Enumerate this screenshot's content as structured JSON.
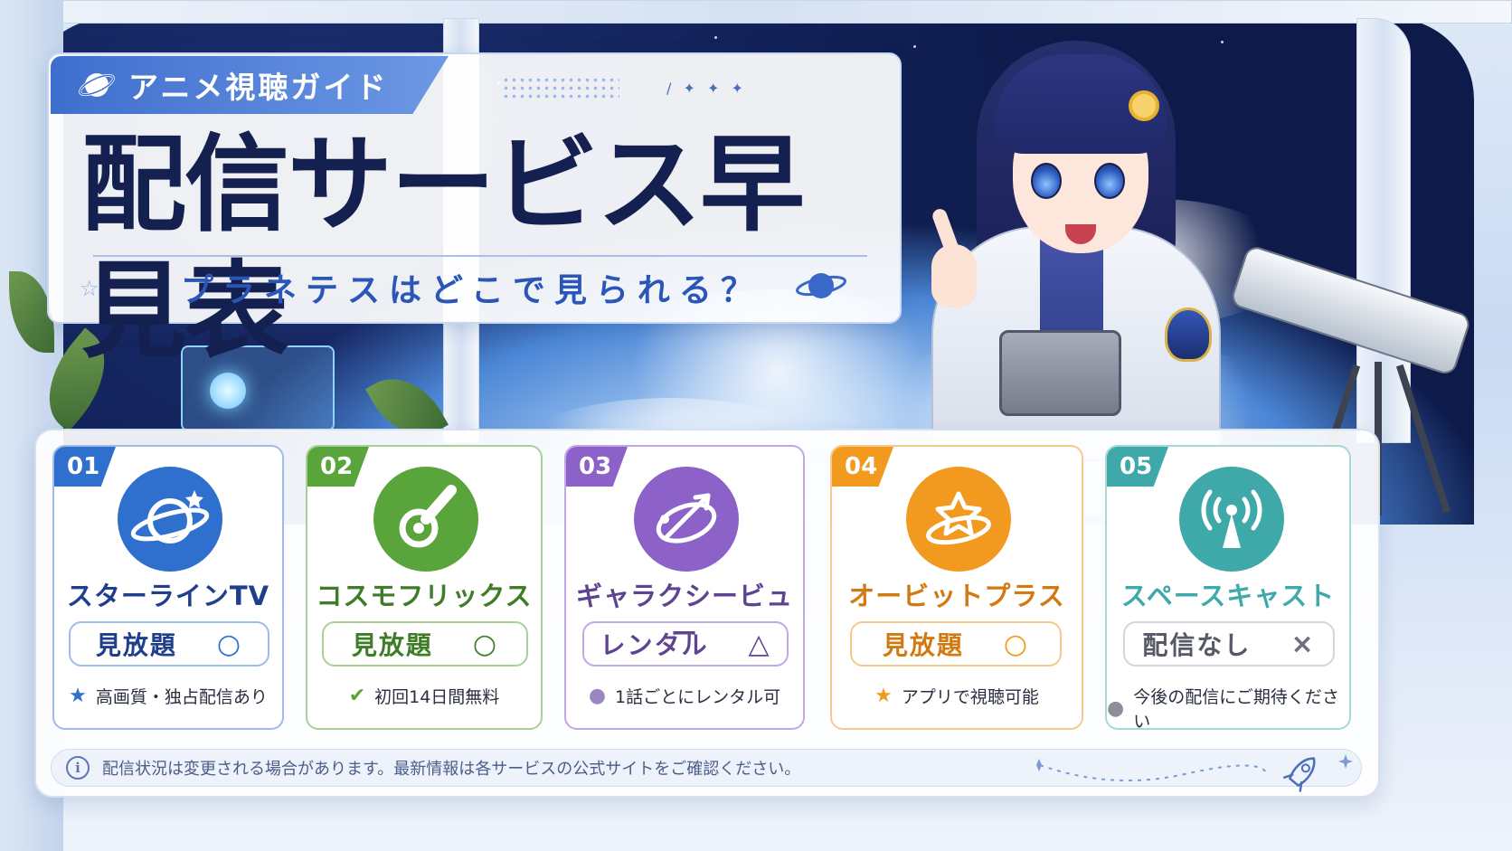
{
  "header": {
    "tag": "アニメ視聴ガイド",
    "title": "配信サービス早見表",
    "subtitle": "プラネテスはどこで見られる？"
  },
  "services": [
    {
      "num": "01",
      "name": "スターラインTV",
      "status": "見放題",
      "mark": "○",
      "note_icon": "star-icon",
      "note_bullet": "★",
      "note": "高画質・独占配信あり",
      "color": "#2f6fcd",
      "pill_text_color": "#1f3f8c"
    },
    {
      "num": "02",
      "name": "コスモフリックス",
      "status": "見放題",
      "mark": "○",
      "note_icon": "check-circle-icon",
      "note_bullet": "✔",
      "note": "初回14日間無料",
      "color": "#5aa43c",
      "pill_text_color": "#3e7d27"
    },
    {
      "num": "03",
      "name": "ギャラクシービュー",
      "status": "レンタル",
      "mark": "△",
      "note_icon": "dot-icon",
      "note_bullet": "●",
      "note": "1話ごとにレンタル可",
      "color": "#8c62c8",
      "pill_text_color": "#5e4490"
    },
    {
      "num": "04",
      "name": "オービットプラス",
      "status": "見放題",
      "mark": "○",
      "note_icon": "star-icon",
      "note_bullet": "★",
      "note": "アプリで視聴可能",
      "color": "#f29a1f",
      "pill_text_color": "#d17a12"
    },
    {
      "num": "05",
      "name": "スペースキャスト",
      "status": "配信なし",
      "mark": "×",
      "note_icon": "dot-icon",
      "note_bullet": "●",
      "note": "今後の配信にご期待ください",
      "color": "#3fa9a9",
      "pill_text_color": "#555a66"
    }
  ],
  "footer": {
    "text": "配信状況は変更される場合があります。最新情報は各サービスの公式サイトをご確認ください。"
  },
  "colors": {
    "title": "#14204f",
    "accent": "#3f6fce",
    "subtitle": "#2a56b8"
  }
}
